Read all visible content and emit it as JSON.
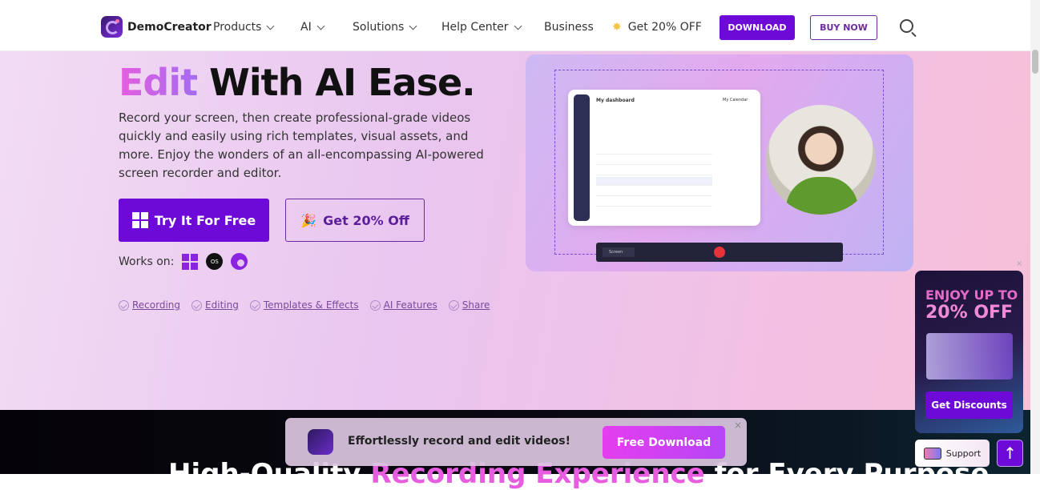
{
  "nav": {
    "brand": "DemoCreator",
    "items": [
      {
        "label": "Products",
        "dropdown": true
      },
      {
        "label": "AI",
        "dropdown": true
      },
      {
        "label": "Solutions",
        "dropdown": true
      },
      {
        "label": "Help Center",
        "dropdown": true
      },
      {
        "label": "Business",
        "dropdown": false
      }
    ],
    "promo": "Get 20% OFF",
    "download": "DOWNLOAD",
    "buy": "BUY NOW"
  },
  "hero": {
    "title_accent": "Edit",
    "title_rest": " With AI Ease.",
    "description": "Record your screen, then create professional-grade videos quickly and easily using rich templates, visual assets, and more. Enjoy the wonders of an all-encompassing AI-powered screen recorder and editor.",
    "try_button": "Try It For Free",
    "off_button": "Get 20% Off",
    "works_on": "Works on:",
    "platforms": [
      "windows-icon",
      "macos-icon",
      "chrome-icon"
    ],
    "mac_label": "OS",
    "features": [
      "Recording",
      "Editing",
      "Templates & Effects",
      "AI Features",
      "Share"
    ]
  },
  "visual": {
    "dashboard_title": "My dashboard",
    "calendar_title": "My Calendar",
    "recorder_source": "Screen"
  },
  "section": {
    "title_start": "High-Quality ",
    "title_accent": "Recording Experience",
    "title_end": " for Every Purpose"
  },
  "sticky": {
    "text": "Effortlessly record and edit videos!",
    "button": "Free Download",
    "close": "×"
  },
  "promo": {
    "line1": "ENJOY UP TO",
    "line2": "20% OFF",
    "button": "Get Discounts",
    "close": "×"
  },
  "support": "Support",
  "colors": {
    "accent": "#6e0ad8",
    "pink": "#e65de0"
  }
}
